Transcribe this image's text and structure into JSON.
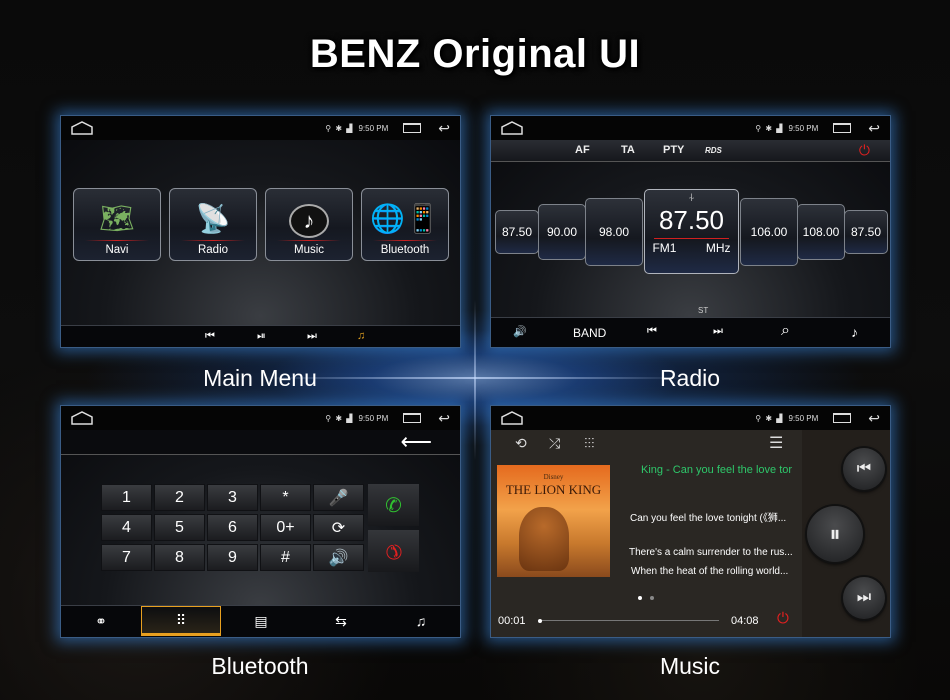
{
  "title": "BENZ Original UI",
  "status_bar": {
    "time": "9:50 PM",
    "icons": [
      "location-icon",
      "bluetooth-icon",
      "signal-icon"
    ]
  },
  "sections": {
    "main_menu": {
      "caption": "Main Menu",
      "apps": [
        {
          "label": "Navi",
          "icon": "map-icon"
        },
        {
          "label": "Radio",
          "icon": "antenna-tower-icon"
        },
        {
          "label": "Music",
          "icon": "music-note-icon"
        },
        {
          "label": "Bluetooth",
          "icon": "phone-globe-icon"
        }
      ],
      "bottom_controls": [
        "⏮",
        "⏯",
        "⏭",
        "♫"
      ]
    },
    "radio": {
      "caption": "Radio",
      "rds": [
        "AF",
        "TA",
        "PTY",
        "RDS"
      ],
      "presets": [
        "87.50",
        "90.00",
        "98.00",
        "106.00",
        "108.00",
        "87.50"
      ],
      "current_freq": "87.50",
      "band": "FM1",
      "unit": "MHz",
      "stereo": "ST",
      "bottom_controls": {
        "volume": "🔊",
        "band": "BAND",
        "prev": "⏮",
        "next": "⏭",
        "search": "⌕",
        "music": "♪"
      }
    },
    "bluetooth": {
      "caption": "Bluetooth",
      "back": "⟵",
      "keys": [
        "1",
        "2",
        "3",
        "*",
        "🎤",
        "4",
        "5",
        "6",
        "0+",
        "⟳",
        "7",
        "8",
        "9",
        "#",
        "🔊"
      ],
      "tabs": [
        {
          "icon": "link-icon",
          "glyph": "⚭"
        },
        {
          "icon": "dialpad-icon",
          "glyph": "⠿",
          "active": true
        },
        {
          "icon": "contacts-icon",
          "glyph": "▤"
        },
        {
          "icon": "call-log-icon",
          "glyph": "⇆"
        },
        {
          "icon": "music-icon",
          "glyph": "♫"
        }
      ]
    },
    "music": {
      "caption": "Music",
      "song_title": "King - Can you feel the love tor",
      "lyrics": [
        "Can you feel the love tonight (《狮...",
        "There's a calm surrender to the rus...",
        "When the heat of the rolling world..."
      ],
      "album_title": "THE LION KING",
      "album_brand": "Disney",
      "elapsed": "00:01",
      "duration": "04:08",
      "progress": 0.004,
      "page_dots": 2,
      "active_page": 1
    }
  },
  "colors": {
    "accent_blue": "#3a8cf0",
    "lyric_green": "#2ec76a",
    "power_red": "#e02020",
    "tab_active": "#e8a020"
  }
}
